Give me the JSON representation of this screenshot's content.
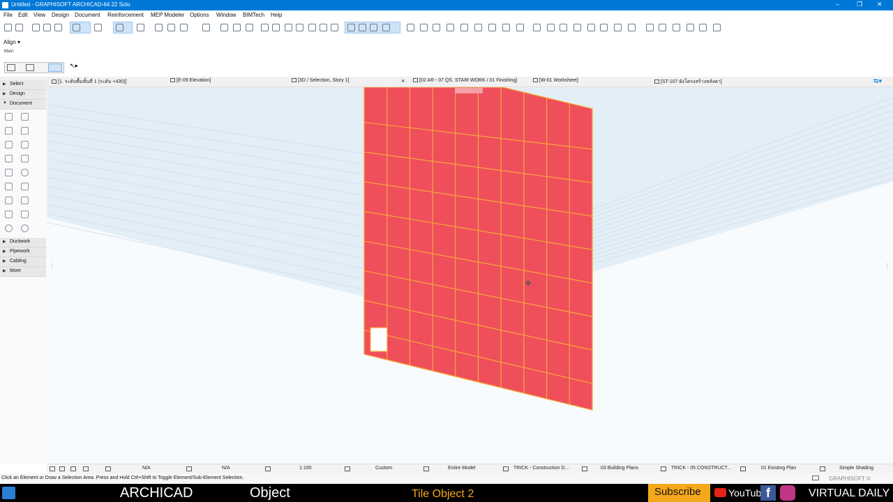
{
  "window": {
    "title": "Untitled - GRAPHISOFT ARCHICAD-64 22 Solo"
  },
  "menu": [
    "File",
    "Edit",
    "View",
    "Design",
    "Document",
    "Reinforcement",
    "MEP Modeler",
    "Options",
    "Window",
    "BIMTech",
    "Help"
  ],
  "infobox": {
    "main_label": "Main:",
    "align_label": "Align"
  },
  "tabs": [
    {
      "label": "[1. ระดับพื้นชั้นที่ 1 (ระดับ +430)]"
    },
    {
      "label": "[E-09 Elevation]"
    },
    {
      "label": "[3D / Selection, Story 1]",
      "close": "×"
    },
    {
      "label": "[02 AR - 07 QS. STAIR WORK / 01 Finishing]"
    },
    {
      "label": "[W-01 Worksheet]"
    },
    {
      "label": "[ST-107 ผังโครงสร้างหลังคา]"
    }
  ],
  "toolbox": {
    "groups_top": [
      {
        "label": "Select",
        "expanded": false
      },
      {
        "label": "Design",
        "expanded": false
      },
      {
        "label": "Document",
        "expanded": true
      }
    ],
    "groups_bottom": [
      {
        "label": "Ductwork"
      },
      {
        "label": "Pipework"
      },
      {
        "label": "Cabling"
      },
      {
        "label": "More"
      }
    ]
  },
  "statusbar": {
    "na1": "N/A",
    "na2": "N/A",
    "scale": "1:100",
    "pen_set": "Custom",
    "model_view": "Entire Model",
    "layer_combo": "TRICK - Construction D...",
    "mvo": "03 Building Plans",
    "renovation": "TRICK - 05 CONSTRUCT...",
    "renovation_filter": "01 Existing Plan",
    "shading": "Simple Shading"
  },
  "prompt": "Click an Element or Draw a Selection Area. Press and Hold Ctrl+Shift to Toggle Element/Sub-Element Selection.",
  "brand": "GRAPHISOFT ©",
  "banner": {
    "archicad": "ARCHICAD",
    "object": "Object",
    "episode": "Tile Object 2",
    "subscribe": "Subscribe",
    "youtube": "YouTube",
    "facebook": "f",
    "channel": "VIRTUAL DAILY"
  },
  "colors": {
    "accent": "#0078d7",
    "tile": "#ef4e5b",
    "tile_grout": "#f7a83a",
    "subscribe_bg": "#f5a91a"
  }
}
